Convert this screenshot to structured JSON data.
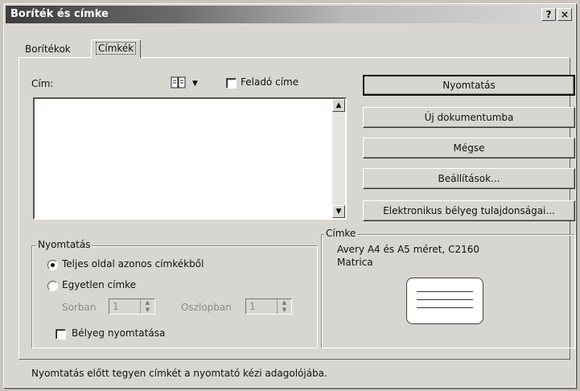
{
  "window": {
    "title": "Boríték és címke",
    "help_button": "?",
    "close_button": "×"
  },
  "tabs": [
    {
      "label": "Borítékok",
      "active": false
    },
    {
      "label": "Címkék",
      "active": true
    }
  ],
  "address": {
    "label": "Cím:",
    "value": "",
    "address_book_icon": "address-book-icon",
    "dropdown_icon": "chevron-down-icon",
    "return_address_checkbox": {
      "label": "Feladó címe",
      "checked": false
    }
  },
  "buttons": {
    "print": "Nyomtatás",
    "new_document": "Új dokumentumba",
    "cancel": "Mégse",
    "options": "Beállítások...",
    "postage_properties": "Elektronikus bélyeg tulajdonságai..."
  },
  "print_group": {
    "legend": "Nyomtatás",
    "full_page": {
      "label": "Teljes oldal azonos címkékből",
      "selected": true
    },
    "single_label": {
      "label": "Egyetlen címke",
      "selected": false
    },
    "row": {
      "label": "Sorban",
      "value": "1"
    },
    "column": {
      "label": "Oszlopban",
      "value": "1"
    },
    "postage_checkbox": {
      "label": "Bélyeg nyomtatása",
      "checked": false
    }
  },
  "label_group": {
    "legend": "Címke",
    "line1": "Avery A4 és A5 méret, C2160",
    "line2": "Matrica"
  },
  "status": {
    "hint": "Nyomtatás előtt tegyen címkét a nyomtató kézi adagolójába."
  },
  "colors": {
    "dialog_bg": "#d8d6d0",
    "titlebar_dark": "#3d3d3d"
  }
}
